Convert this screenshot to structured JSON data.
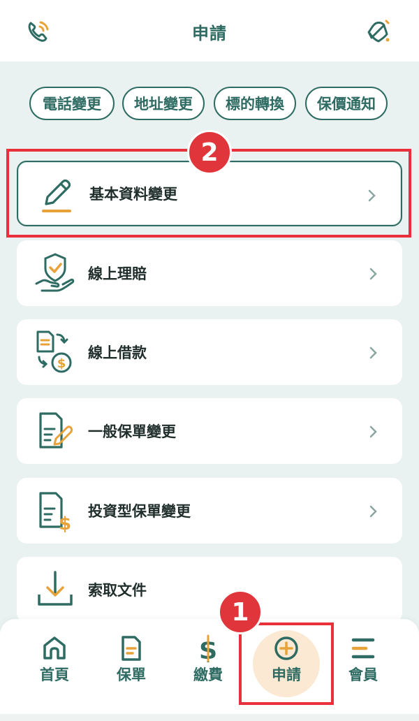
{
  "header": {
    "title": "申請",
    "left_icon": "phone-icon",
    "right_icon": "notification-bell-icon"
  },
  "chips": [
    {
      "label": "電話變更"
    },
    {
      "label": "地址變更"
    },
    {
      "label": "標的轉換"
    },
    {
      "label": "保價通知"
    }
  ],
  "menu": [
    {
      "label": "基本資料變更",
      "icon": "pencil-edit-icon"
    },
    {
      "label": "線上理賠",
      "icon": "shield-hand-icon"
    },
    {
      "label": "線上借款",
      "icon": "document-exchange-money-icon"
    },
    {
      "label": "一般保單變更",
      "icon": "document-pencil-icon"
    },
    {
      "label": "投資型保單變更",
      "icon": "document-dollar-icon"
    },
    {
      "label": "索取文件",
      "icon": "download-icon"
    }
  ],
  "annotations": {
    "step1": "1",
    "step2": "2"
  },
  "bottom_nav": [
    {
      "label": "首頁",
      "icon": "home-icon"
    },
    {
      "label": "保單",
      "icon": "policy-document-icon"
    },
    {
      "label": "繳費",
      "icon": "dollar-icon"
    },
    {
      "label": "申請",
      "icon": "plus-circle-icon"
    },
    {
      "label": "會員",
      "icon": "menu-lines-icon"
    }
  ],
  "colors": {
    "primary": "#2e6b62",
    "accent": "#e8a23a",
    "highlight": "#e8313b",
    "background": "#e9f2f0"
  }
}
